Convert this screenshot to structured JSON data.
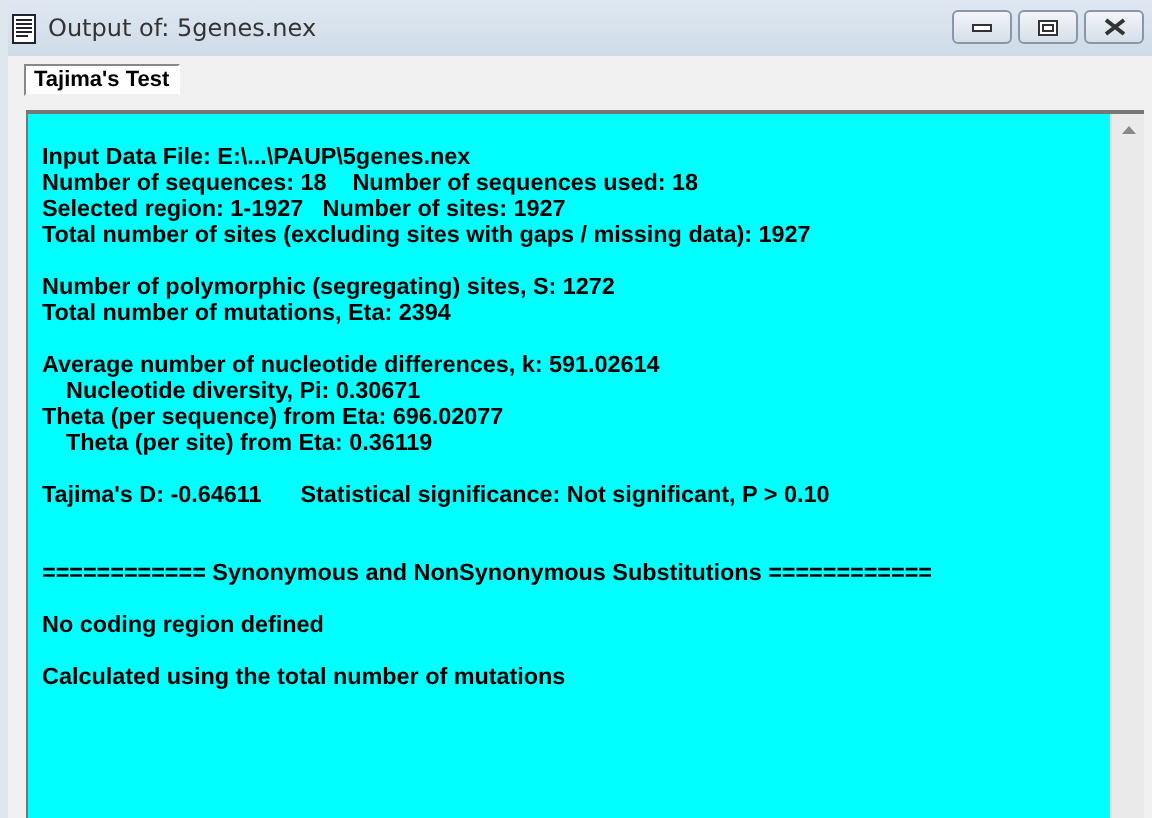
{
  "window": {
    "title": "Output of: 5genes.nex"
  },
  "tabs": [
    {
      "label": "Tajima's Test",
      "selected": true
    }
  ],
  "output": {
    "blocks": [
      {
        "kind": "normal",
        "lines": [
          {
            "kind": "plain",
            "text": "Input Data File: E:\\...\\PAUP\\5genes.nex"
          },
          {
            "kind": "plain",
            "text": "Number of sequences: 18    Number of sequences used: 18"
          },
          {
            "kind": "plain",
            "text": "Selected region: 1-1927   Number of sites: 1927"
          },
          {
            "kind": "plain",
            "text": "Total number of sites (excluding sites with gaps / missing data): 1927"
          }
        ]
      },
      {
        "kind": "normal",
        "lines": [
          {
            "kind": "plain",
            "text": "Number of polymorphic (segregating) sites, S: 1272"
          },
          {
            "kind": "plain",
            "text": "Total number of mutations, Eta: 2394"
          }
        ]
      },
      {
        "kind": "normal",
        "lines": [
          {
            "kind": "plain",
            "text": "Average number of nucleotide differences, k: 591.02614"
          },
          {
            "kind": "indented",
            "text": "Nucleotide diversity, Pi: 0.30671"
          },
          {
            "kind": "plain",
            "text": "Theta (per sequence) from Eta: 696.02077"
          },
          {
            "kind": "indented",
            "text": "Theta (per site) from Eta: 0.36119"
          }
        ]
      },
      {
        "kind": "normal",
        "lines": [
          {
            "kind": "plain",
            "text": "Tajima's D: -0.64611      Statistical significance: Not significant, P > 0.10"
          }
        ]
      },
      {
        "kind": "section",
        "lines": [
          {
            "kind": "plain",
            "text": "============ Synonymous and NonSynonymous Substitutions ============"
          }
        ]
      },
      {
        "kind": "normal",
        "lines": [
          {
            "kind": "plain",
            "text": "No coding region defined"
          }
        ]
      },
      {
        "kind": "normal",
        "lines": [
          {
            "kind": "plain",
            "text": "Calculated using the total number of mutations"
          }
        ]
      }
    ]
  }
}
